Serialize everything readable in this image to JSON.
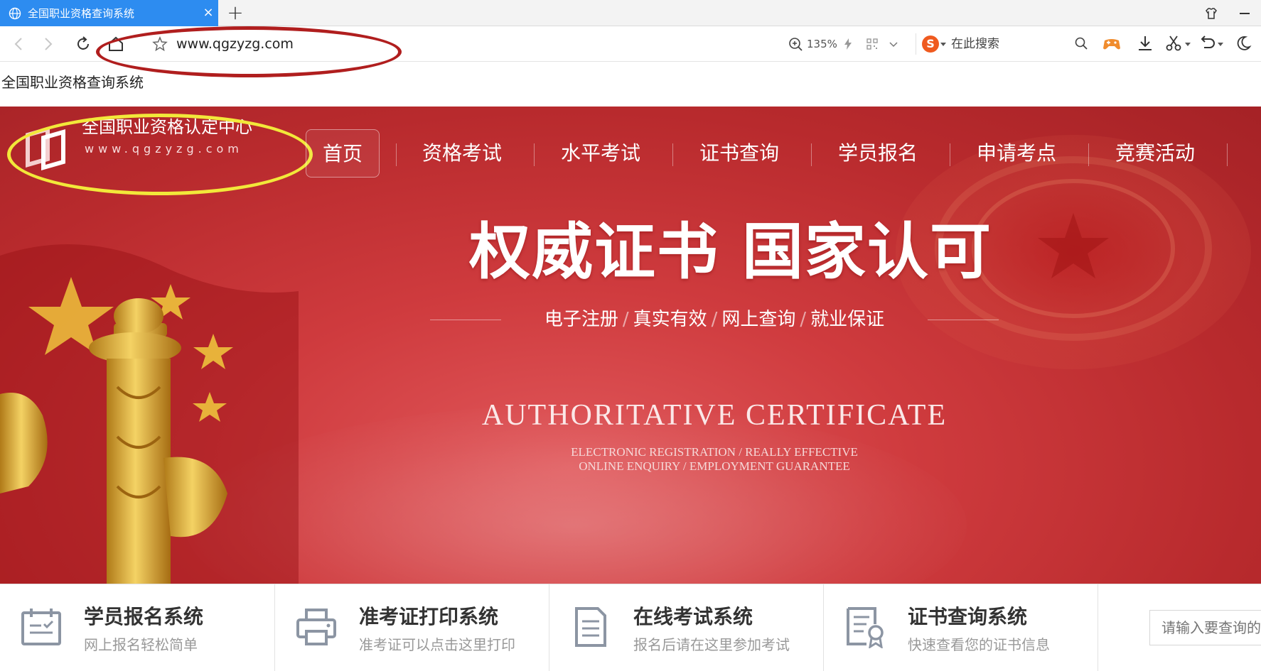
{
  "browser": {
    "tab_title": "全国职业资格查询系统",
    "tab_close": "×",
    "new_tab": "+",
    "url": "www.qgzyzg.com",
    "zoom": "135%",
    "search_engine_glyph": "S",
    "search_placeholder": "在此搜索"
  },
  "page": {
    "doc_title": "全国职业资格查询系统"
  },
  "header": {
    "logo_title": "全国职业资格认定中心",
    "logo_subtitle": "www.qgzyzg.com",
    "nav": [
      {
        "label": "首页"
      },
      {
        "label": "资格考试"
      },
      {
        "label": "水平考试"
      },
      {
        "label": "证书查询"
      },
      {
        "label": "学员报名"
      },
      {
        "label": "申请考点"
      },
      {
        "label": "竞赛活动"
      }
    ]
  },
  "hero": {
    "headline": "权威证书 国家认可",
    "taglines": [
      "电子注册",
      "真实有效",
      "网上查询",
      "就业保证"
    ],
    "tagline_separator": "/",
    "english_title": "AUTHORITATIVE CERTIFICATE",
    "english_sub_1": "ELECTRONIC REGISTRATION / REALLY EFFECTIVE",
    "english_sub_2": "ONLINE ENQUIRY / EMPLOYMENT GUARANTEE"
  },
  "services": [
    {
      "title": "学员报名系统",
      "desc": "网上报名轻松简单",
      "icon": "clipboard-check-icon"
    },
    {
      "title": "准考证打印系统",
      "desc": "准考证可以点击这里打印",
      "icon": "printer-icon"
    },
    {
      "title": "在线考试系统",
      "desc": "报名后请在这里参加考试",
      "icon": "document-icon"
    },
    {
      "title": "证书查询系统",
      "desc": "快速查看您的证书信息",
      "icon": "certificate-icon"
    }
  ],
  "query": {
    "placeholder": "请输入要查询的"
  },
  "colors": {
    "tab_active": "#2d8cf0",
    "banner_red": "#c9363a",
    "annotation_red": "#b01e1e",
    "annotation_yellow": "#f2e83a",
    "icon_gray": "#8c95a3"
  }
}
